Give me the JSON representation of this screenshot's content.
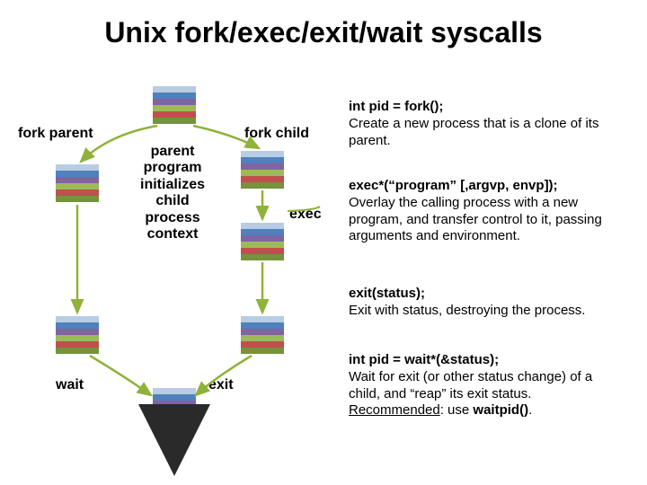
{
  "title": "Unix fork/exec/exit/wait syscalls",
  "labels": {
    "fork_parent": "fork parent",
    "fork_child": "fork child",
    "center": "parent\nprogram\ninitializes\nchild\nprocess\ncontext",
    "exec": "exec",
    "wait": "wait",
    "exit": "exit"
  },
  "desc": {
    "fork_sig": "int pid = fork();",
    "fork_txt": "Create a new process that is a clone of its parent.",
    "exec_sig": "exec*(“program” [,argvp, envp]);",
    "exec_txt": "Overlay the calling process with a new program, and transfer control to it, passing arguments and environment.",
    "exit_sig": "exit(status);",
    "exit_txt": "Exit with status, destroying the process.",
    "wait_sig": "int pid = wait*(&status);",
    "wait_txt1": "Wait for exit (or other status change) of a child, and “reap” its exit status.",
    "wait_txt2_pre": "Recommended",
    "wait_txt2_mid": ": use ",
    "wait_txt2_bold": "waitpid()",
    "wait_txt2_post": "."
  },
  "colors": {
    "arrow_green": "#8fb23a",
    "arrow_dark": "#2a2a2a"
  }
}
